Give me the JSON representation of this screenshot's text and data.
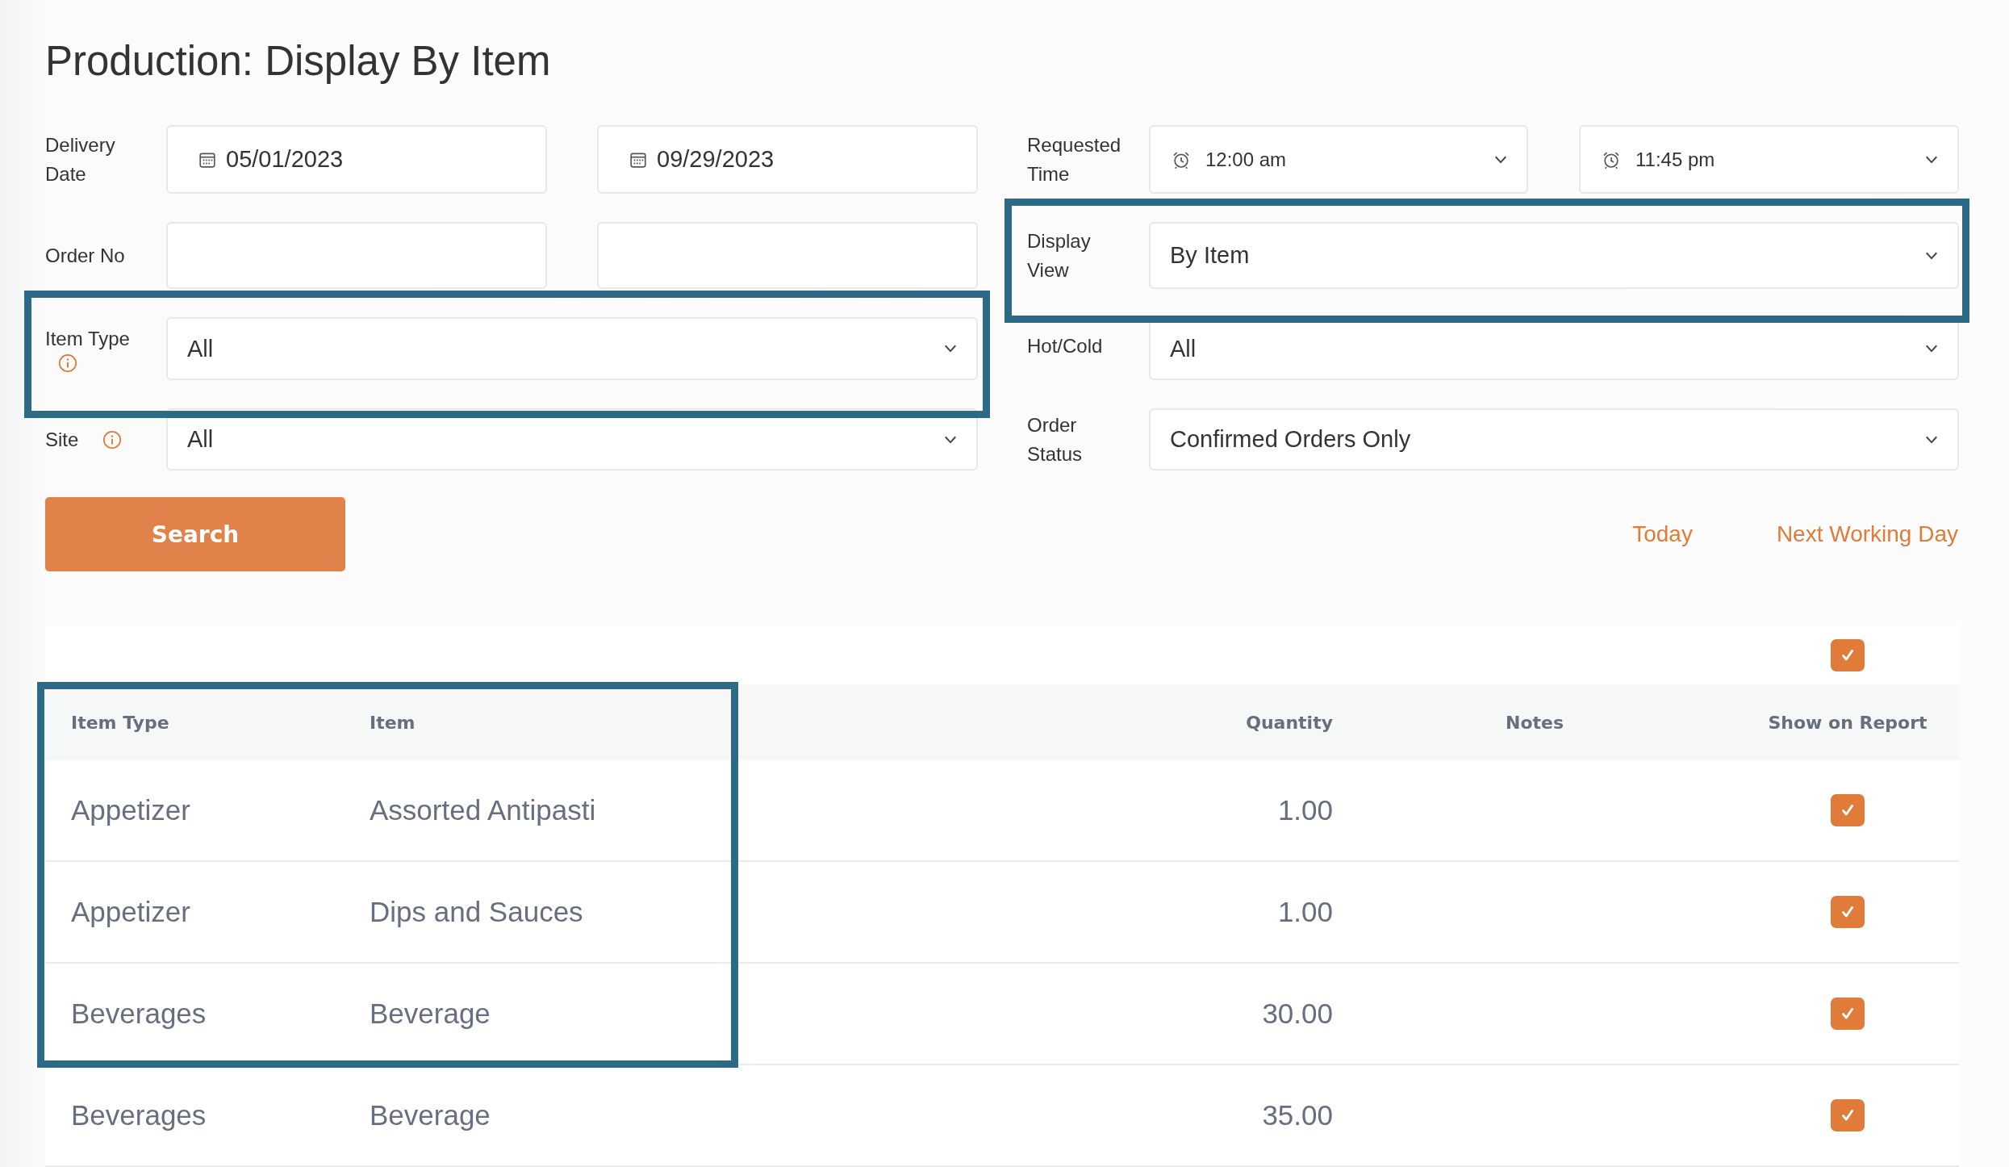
{
  "page_title": "Production: Display By Item",
  "filters": {
    "delivery_date": {
      "label": "Delivery Date",
      "from": "05/01/2023",
      "to": "09/29/2023"
    },
    "order_no": {
      "label": "Order No"
    },
    "item_type": {
      "label": "Item Type",
      "value": "All",
      "info": true
    },
    "site": {
      "label": "Site",
      "value": "All",
      "info": true
    },
    "requested_time": {
      "label": "Requested Time",
      "from": "12:00 am",
      "to": "11:45 pm"
    },
    "display_view": {
      "label": "Display View",
      "value": "By Item"
    },
    "hot_cold": {
      "label": "Hot/Cold",
      "value": "All"
    },
    "order_status": {
      "label": "Order Status",
      "value": "Confirmed Orders Only"
    }
  },
  "search_button": "Search",
  "quick_links": [
    "Today",
    "Next Working Day"
  ],
  "table": {
    "select_all_checked": true,
    "columns": [
      "Item Type",
      "Item",
      "Quantity",
      "Notes",
      "Show on Report"
    ],
    "rows": [
      {
        "item_type": "Appetizer",
        "item": "Assorted Antipasti",
        "quantity": "1.00",
        "show_on_report": true
      },
      {
        "item_type": "Appetizer",
        "item": "Dips and Sauces",
        "quantity": "1.00",
        "show_on_report": true
      },
      {
        "item_type": "Beverages",
        "item": "Beverage",
        "quantity": "30.00",
        "show_on_report": true
      },
      {
        "item_type": "Beverages",
        "item": "Beverage",
        "quantity": "35.00",
        "show_on_report": true
      }
    ]
  }
}
